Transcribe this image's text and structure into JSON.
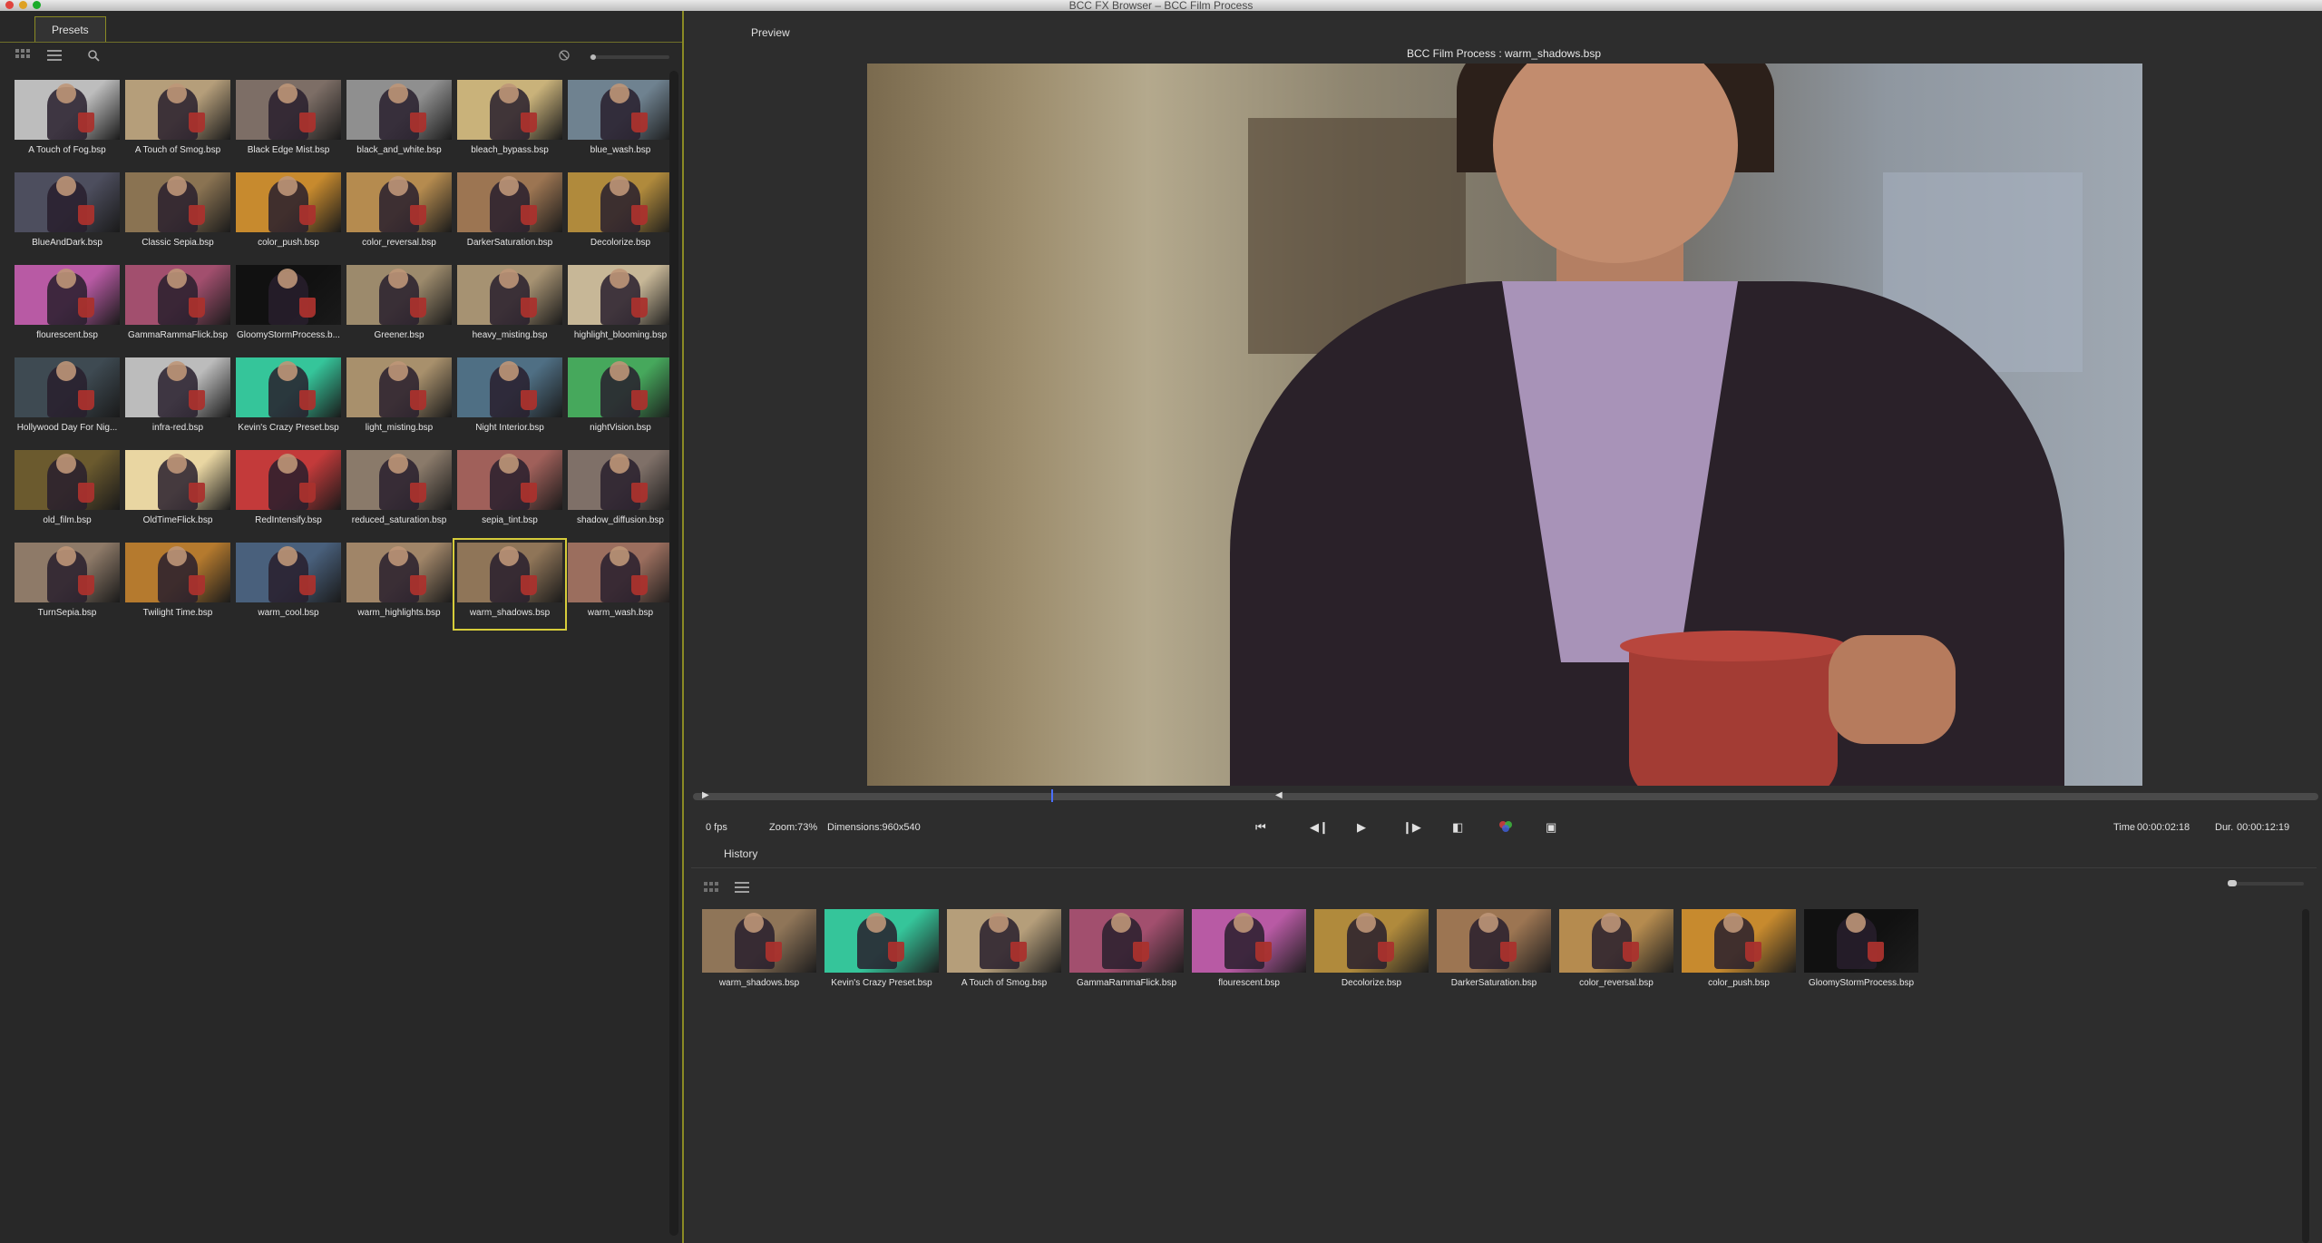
{
  "window": {
    "title": "BCC FX Browser – BCC Film Process"
  },
  "left_panel": {
    "tab_label": "Presets",
    "presets": [
      {
        "label": "A Touch of Fog.bsp",
        "tint": "#bdbdbd"
      },
      {
        "label": "A Touch of Smog.bsp",
        "tint": "#b59e7a"
      },
      {
        "label": "Black Edge Mist.bsp",
        "tint": "#7d6e66"
      },
      {
        "label": "black_and_white.bsp",
        "tint": "#8f8f8f"
      },
      {
        "label": "bleach_bypass.bsp",
        "tint": "#c9b27a"
      },
      {
        "label": "blue_wash.bsp",
        "tint": "#6f8290"
      },
      {
        "label": "BlueAndDark.bsp",
        "tint": "#4d4e5e"
      },
      {
        "label": "Classic Sepia.bsp",
        "tint": "#8a7352"
      },
      {
        "label": "color_push.bsp",
        "tint": "#c78a2e"
      },
      {
        "label": "color_reversal.bsp",
        "tint": "#b58b4f"
      },
      {
        "label": "DarkerSaturation.bsp",
        "tint": "#9c7552"
      },
      {
        "label": "Decolorize.bsp",
        "tint": "#b08a3c"
      },
      {
        "label": "flourescent.bsp",
        "tint": "#b85aa4"
      },
      {
        "label": "GammaRammaFlick.bsp",
        "tint": "#a24f6e"
      },
      {
        "label": "GloomyStormProcess.b...",
        "tint": "#111111"
      },
      {
        "label": "Greener.bsp",
        "tint": "#9c8a6c"
      },
      {
        "label": "heavy_misting.bsp",
        "tint": "#a69272"
      },
      {
        "label": "highlight_blooming.bsp",
        "tint": "#c7b797"
      },
      {
        "label": "Hollywood Day For Nig...",
        "tint": "#3e4a52"
      },
      {
        "label": "infra-red.bsp",
        "tint": "#bcbcbc"
      },
      {
        "label": "Kevin's Crazy Preset.bsp",
        "tint": "#35c59a"
      },
      {
        "label": "light_misting.bsp",
        "tint": "#a8906c"
      },
      {
        "label": "Night Interior.bsp",
        "tint": "#4f6f84"
      },
      {
        "label": "nightVision.bsp",
        "tint": "#46a85c"
      },
      {
        "label": "old_film.bsp",
        "tint": "#6b5a2e"
      },
      {
        "label": "OldTimeFlick.bsp",
        "tint": "#e9d6a2"
      },
      {
        "label": "RedIntensify.bsp",
        "tint": "#c33a3a"
      },
      {
        "label": "reduced_saturation.bsp",
        "tint": "#8a7a6a"
      },
      {
        "label": "sepia_tint.bsp",
        "tint": "#a0605a"
      },
      {
        "label": "shadow_diffusion.bsp",
        "tint": "#7f7068"
      },
      {
        "label": "TurnSepia.bsp",
        "tint": "#8e7a68"
      },
      {
        "label": "Twilight Time.bsp",
        "tint": "#b57a2e"
      },
      {
        "label": "warm_cool.bsp",
        "tint": "#49607c"
      },
      {
        "label": "warm_highlights.bsp",
        "tint": "#a08568"
      },
      {
        "label": "warm_shadows.bsp",
        "tint": "#8f7558",
        "selected": true
      },
      {
        "label": "warm_wash.bsp",
        "tint": "#9b6e5e"
      }
    ]
  },
  "preview": {
    "tab_label": "Preview",
    "title": "BCC Film Process : warm_shadows.bsp",
    "fps": "0 fps",
    "zoom": "Zoom:73%",
    "dimensions": "Dimensions:960x540",
    "time_label": "Time",
    "time_value": "00:00:02:18",
    "dur_label": "Dur.",
    "dur_value": "00:00:12:19"
  },
  "history": {
    "tab_label": "History",
    "items": [
      {
        "label": "warm_shadows.bsp",
        "tint": "#8f7558"
      },
      {
        "label": "Kevin's Crazy Preset.bsp",
        "tint": "#35c59a"
      },
      {
        "label": "A Touch of Smog.bsp",
        "tint": "#b59e7a"
      },
      {
        "label": "GammaRammaFlick.bsp",
        "tint": "#a24f6e"
      },
      {
        "label": "flourescent.bsp",
        "tint": "#b85aa4"
      },
      {
        "label": "Decolorize.bsp",
        "tint": "#b08a3c"
      },
      {
        "label": "DarkerSaturation.bsp",
        "tint": "#9c7552"
      },
      {
        "label": "color_reversal.bsp",
        "tint": "#b58b4f"
      },
      {
        "label": "color_push.bsp",
        "tint": "#c78a2e"
      },
      {
        "label": "GloomyStormProcess.bsp",
        "tint": "#111111"
      }
    ]
  },
  "icons": {
    "grid_view": "grid-view-icon",
    "list_view": "list-view-icon",
    "search": "search-icon",
    "clear": "clear-icon"
  },
  "colors": {
    "selection": "#d6cc3a",
    "playhead": "#4b6fff",
    "panel_border": "#8a8a24"
  }
}
